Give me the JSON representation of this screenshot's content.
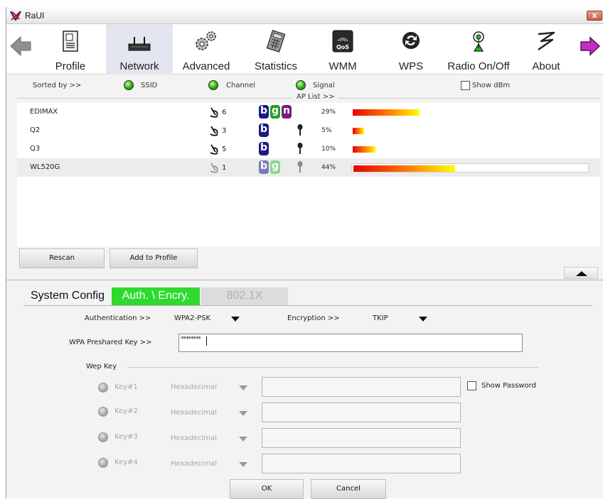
{
  "window": {
    "title": "RaUI",
    "close_label": "x"
  },
  "toolbar": {
    "items": [
      {
        "label": "Profile",
        "icon": "profile-icon"
      },
      {
        "label": "Network",
        "icon": "network-icon",
        "active": true
      },
      {
        "label": "Advanced",
        "icon": "gears-icon"
      },
      {
        "label": "Statistics",
        "icon": "calculator-icon"
      },
      {
        "label": "WMM",
        "icon": "qos-icon"
      },
      {
        "label": "WPS",
        "icon": "wps-icon"
      },
      {
        "label": "Radio On/Off",
        "icon": "radio-antenna-icon"
      },
      {
        "label": "About",
        "icon": "about-icon"
      }
    ],
    "back_icon": "back-arrow-icon",
    "forward_icon": "forward-arrow-icon",
    "forward_color": "#b020b0"
  },
  "site_survey": {
    "sorted_by_label": "Sorted by >>",
    "sort_options": [
      "SSID",
      "Channel",
      "Signal"
    ],
    "show_dbm_label": "Show dBm",
    "show_dbm_checked": false,
    "ap_list_label": "AP List >>",
    "networks": [
      {
        "ssid": "EDIMAX",
        "channel": "6",
        "modes": [
          "b",
          "g",
          "n"
        ],
        "secured": false,
        "signal": "29%",
        "signal_level": 0.29
      },
      {
        "ssid": "Q2",
        "channel": "3",
        "modes": [
          "b"
        ],
        "secured": true,
        "signal": "5%",
        "signal_level": 0.05
      },
      {
        "ssid": "Q3",
        "channel": "5",
        "modes": [
          "b"
        ],
        "secured": true,
        "signal": "10%",
        "signal_level": 0.1
      },
      {
        "ssid": "WL520G",
        "channel": "1",
        "modes": [
          "b",
          "g"
        ],
        "secured": true,
        "signal": "44%",
        "signal_level": 0.44,
        "selected": true
      }
    ],
    "rescan_label": "Rescan",
    "add_profile_label": "Add to Profile"
  },
  "config_tabs": [
    {
      "label": "System Config",
      "state": "normal"
    },
    {
      "label": "Auth. \\ Encry.",
      "state": "active"
    },
    {
      "label": "802.1X",
      "state": "disabled"
    }
  ],
  "auth": {
    "authentication_label": "Authentication >>",
    "authentication_value": "WPA2-PSK",
    "encryption_label": "Encryption >>",
    "encryption_value": "TKIP",
    "psk_label": "WPA Preshared Key >>",
    "psk_value": "********"
  },
  "wep": {
    "group_label": "Wep Key",
    "keys": [
      {
        "label": "Key#1",
        "format": "Hexadecimal",
        "value": ""
      },
      {
        "label": "Key#2",
        "format": "Hexadecimal",
        "value": ""
      },
      {
        "label": "Key#3",
        "format": "Hexadecimal",
        "value": ""
      },
      {
        "label": "Key#4",
        "format": "Hexadecimal",
        "value": ""
      }
    ],
    "show_password_label": "Show Password",
    "show_password_checked": false
  },
  "footer": {
    "ok_label": "OK",
    "cancel_label": "Cancel"
  }
}
